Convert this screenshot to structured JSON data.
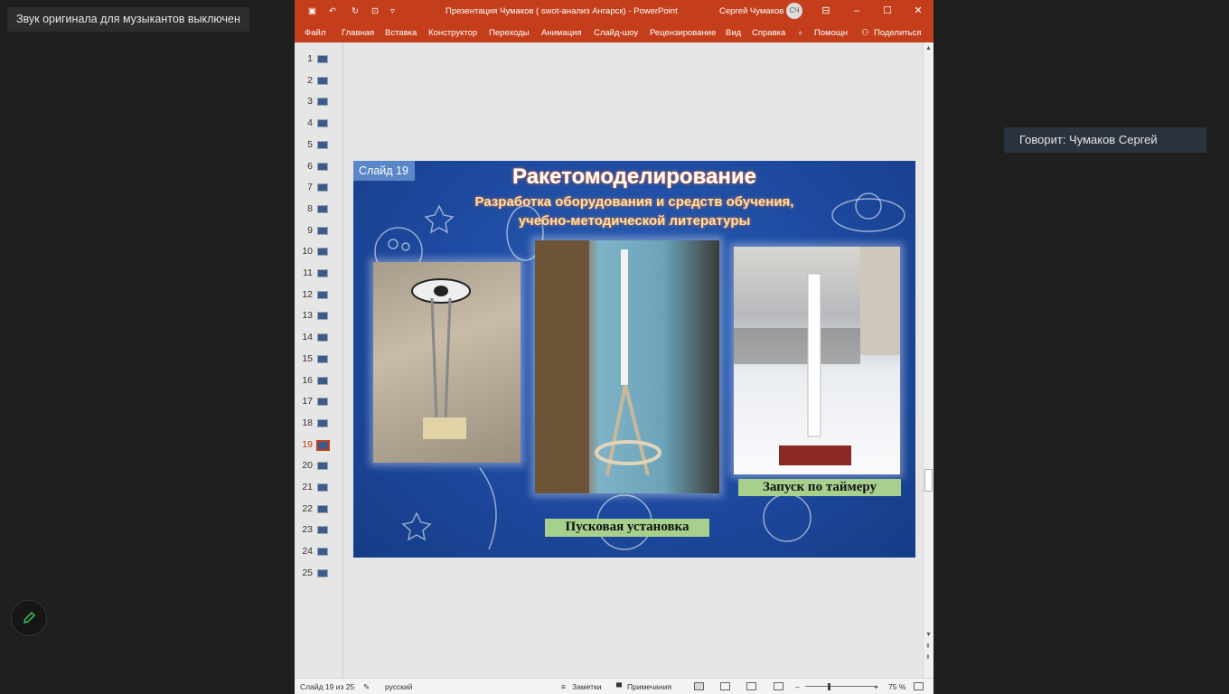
{
  "overlay": {
    "notice": "Звук оригинала для музыкантов выключен",
    "speaker": "Говорит: Чумаков Сергей"
  },
  "titlebar": {
    "doc_title": "Презентация Чумаков ( swot-анализ Ангарск)  -  PowerPoint",
    "user": "Сергей Чумаков",
    "avatar": "СЧ"
  },
  "ribbon": {
    "tabs": [
      "Файл",
      "Главная",
      "Вставка",
      "Конструктор",
      "Переходы",
      "Анимация",
      "Слайд-шоу",
      "Рецензирование",
      "Вид",
      "Справка",
      "Помощн",
      "Поделиться"
    ]
  },
  "thumbnails": [
    "1",
    "2",
    "3",
    "4",
    "5",
    "6",
    "7",
    "8",
    "9",
    "10",
    "11",
    "12",
    "13",
    "14",
    "15",
    "16",
    "17",
    "18",
    "19",
    "20",
    "21",
    "22",
    "23",
    "24",
    "25"
  ],
  "active_slide": 19,
  "slide": {
    "tag": "Слайд 19",
    "title": "Ракетомоделирование",
    "subtitle1": "Разработка оборудования и средств обучения,",
    "subtitle2": "учебно-методической литературы",
    "caption_launch": "Пусковая установка",
    "caption_timer": "Запуск по таймеру"
  },
  "status": {
    "slide_of": "Слайд 19 из 25",
    "language": "русский",
    "notes": "Заметки",
    "comments": "Примечания",
    "zoom": "75 %"
  },
  "colors": {
    "accent": "#c43e1c",
    "caption_bg": "#a8d08d"
  }
}
